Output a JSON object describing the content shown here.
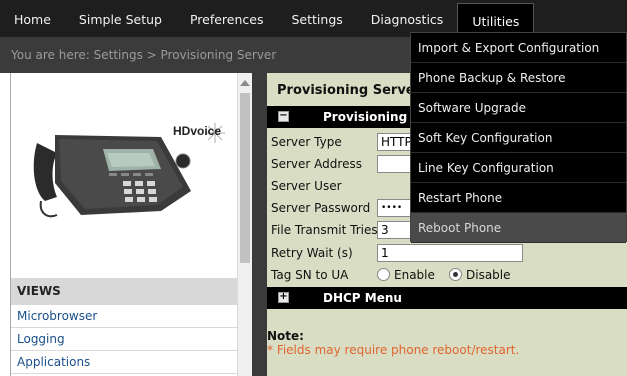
{
  "nav": {
    "items": [
      {
        "label": "Home"
      },
      {
        "label": "Simple Setup"
      },
      {
        "label": "Preferences"
      },
      {
        "label": "Settings"
      },
      {
        "label": "Diagnostics"
      },
      {
        "label": "Utilities"
      }
    ]
  },
  "breadcrumb": "You are here: Settings > Provisioning Server",
  "sidebar": {
    "phone_brand": "HDvoice",
    "views_title": "VIEWS",
    "views": [
      {
        "label": "Microbrowser"
      },
      {
        "label": "Logging"
      },
      {
        "label": "Applications"
      }
    ]
  },
  "main": {
    "title": "Provisioning Serve",
    "section1": {
      "toggle": "−",
      "label": "Provisioning S"
    },
    "fields": [
      {
        "label": "Server Type",
        "value": "HTTP"
      },
      {
        "label": "Server Address",
        "value": ""
      },
      {
        "label": "Server User",
        "value": ""
      },
      {
        "label": "Server Password",
        "value": "••••"
      },
      {
        "label": "File Transmit Tries",
        "value": "3"
      },
      {
        "label": "Retry Wait (s)",
        "value": "1"
      }
    ],
    "tag_sn": {
      "label": "Tag SN to UA",
      "option_enable": "Enable",
      "option_disable": "Disable",
      "selected": "Disable"
    },
    "section2": {
      "toggle": "+",
      "label": "DHCP Menu"
    },
    "note_title": "Note:",
    "note_text": "* Fields may require phone reboot/restart."
  },
  "utilities_menu": {
    "items": [
      {
        "label": "Import & Export Configuration"
      },
      {
        "label": "Phone Backup & Restore"
      },
      {
        "label": "Software Upgrade"
      },
      {
        "label": "Soft Key Configuration"
      },
      {
        "label": "Line Key Configuration"
      },
      {
        "label": "Restart Phone"
      },
      {
        "label": "Reboot Phone"
      }
    ],
    "hovered": "Reboot Phone"
  },
  "colors": {
    "nav_bg": "#1e1e1e",
    "band_bg": "#3b3b3b",
    "content_bg": "#d9ddc4",
    "link": "#1a4f8a",
    "note": "#e0652e"
  }
}
